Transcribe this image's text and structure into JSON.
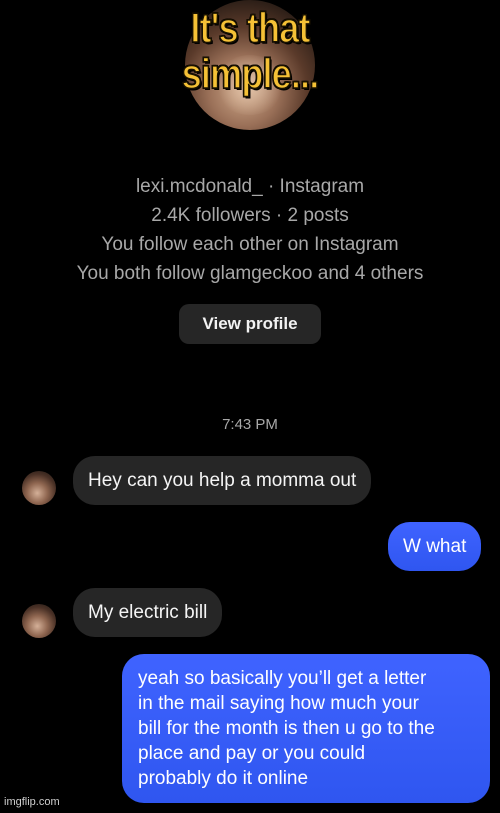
{
  "meme": {
    "caption_line1": "It's that",
    "caption_line2": "simple..."
  },
  "profile": {
    "title": "lexi.mcdonald_ · Instagram",
    "stats": "2.4K followers · 2 posts",
    "follow_status": "You follow each other on Instagram",
    "mutuals": "You both follow glamgeckoo and 4 others",
    "view_profile_label": "View profile"
  },
  "chat": {
    "timestamp": "7:43 PM",
    "messages": [
      {
        "sender": "them",
        "text": "Hey can you help a momma out"
      },
      {
        "sender": "me",
        "text": "W what"
      },
      {
        "sender": "them",
        "text": "My electric bill"
      },
      {
        "sender": "me",
        "lines": [
          "yeah so basically you’ll get a letter",
          "in the mail saying how much your",
          "bill for the month is then u go to the",
          "place and pay or you could",
          "probably do it online"
        ]
      }
    ]
  },
  "watermark": "imgflip.com",
  "colors": {
    "background": "#000000",
    "incoming_bubble": "#262626",
    "outgoing_bubble": "#3a5cf6",
    "caption": "#f5c136"
  }
}
